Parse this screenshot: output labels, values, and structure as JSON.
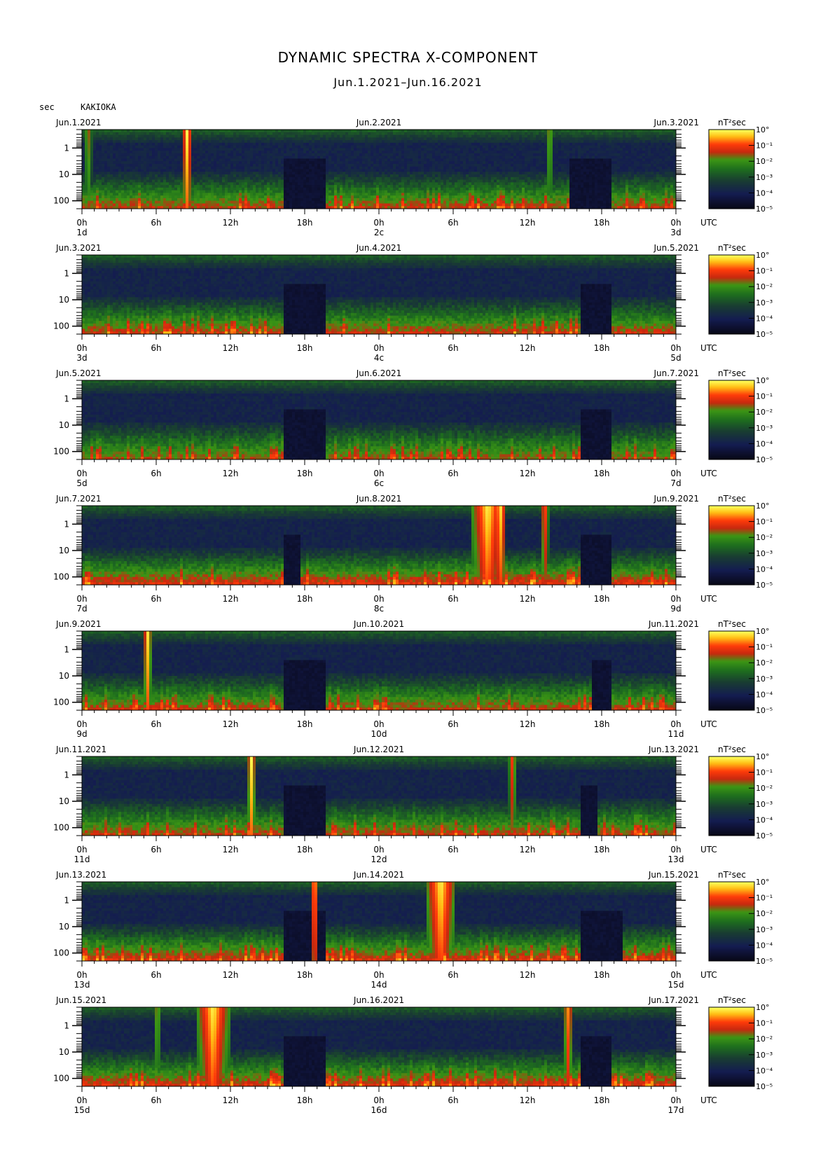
{
  "title": "DYNAMIC SPECTRA X-COMPONENT",
  "subtitle": "Jun.1.2021–Jun.16.2021",
  "y_unit": "sec",
  "station": "KAKIOKA",
  "colorbar_unit": "nT²sec",
  "colorbar_ticks": [
    "10°",
    "10⁻¹",
    "10⁻²",
    "10⁻³",
    "10⁻⁴",
    "10⁻⁵"
  ],
  "utc_label": "UTC",
  "chart_data": {
    "type": "heatmap",
    "description_axes": "x = time (hours UTC, 0-48 per panel), y = period (sec, log scale, 0.2-200), color = power spectral density",
    "x_ticks": [
      "0h",
      "6h",
      "12h",
      "18h",
      "0h",
      "6h",
      "12h",
      "18h",
      "0h"
    ],
    "y_ticks": [
      "1",
      "10",
      "100"
    ],
    "colorscale": [
      "#0a0a20",
      "#1a2060",
      "#1e4a30",
      "#2e8a20",
      "#cc2a10",
      "#ff5010",
      "#ffd020",
      "#ffff60"
    ],
    "panels": [
      {
        "left_date": "Jun.1.2021",
        "mid_date": "Jun.2.2021",
        "right_date": "Jun.3.2021",
        "day_labels": [
          "1d",
          "2c",
          "3d"
        ],
        "events": [
          {
            "t": 0.5,
            "w": 0.3,
            "intensity": 0.75
          },
          {
            "t": 8.5,
            "w": 0.4,
            "intensity": 1.0
          },
          {
            "t": 37.8,
            "w": 0.3,
            "intensity": 0.75
          }
        ],
        "quiet": [
          [
            16,
            20
          ],
          [
            39,
            43
          ]
        ],
        "activity": 0.6
      },
      {
        "left_date": "Jun.3.2021",
        "mid_date": "Jun.4.2021",
        "right_date": "Jun.5.2021",
        "day_labels": [
          "3d",
          "4c",
          "5d"
        ],
        "events": [],
        "quiet": [
          [
            16,
            20
          ],
          [
            40,
            43
          ]
        ],
        "activity": 0.65
      },
      {
        "left_date": "Jun.5.2021",
        "mid_date": "Jun.6.2021",
        "right_date": "Jun.7.2021",
        "day_labels": [
          "5d",
          "6c",
          "7d"
        ],
        "events": [],
        "quiet": [
          [
            16,
            20
          ],
          [
            40,
            43
          ]
        ],
        "activity": 0.45
      },
      {
        "left_date": "Jun.7.2021",
        "mid_date": "Jun.8.2021",
        "right_date": "Jun.9.2021",
        "day_labels": [
          "7d",
          "8c",
          "9d"
        ],
        "events": [
          {
            "t": 32.8,
            "w": 1.3,
            "intensity": 1.0
          },
          {
            "t": 33.8,
            "w": 0.5,
            "intensity": 1.0
          },
          {
            "t": 37.4,
            "w": 0.3,
            "intensity": 0.9
          }
        ],
        "quiet": [
          [
            16,
            18
          ],
          [
            40,
            43
          ]
        ],
        "activity": 0.8
      },
      {
        "left_date": "Jun.9.2021",
        "mid_date": "Jun.10.2021",
        "right_date": "Jun.11.2021",
        "day_labels": [
          "9d",
          "10d",
          "11d"
        ],
        "events": [
          {
            "t": 5.3,
            "w": 0.3,
            "intensity": 1.0
          }
        ],
        "quiet": [
          [
            16,
            20
          ],
          [
            41,
            43
          ]
        ],
        "activity": 0.6
      },
      {
        "left_date": "Jun.11.2021",
        "mid_date": "Jun.12.2021",
        "right_date": "Jun.13.2021",
        "day_labels": [
          "11d",
          "12d",
          "13d"
        ],
        "events": [
          {
            "t": 13.7,
            "w": 0.3,
            "intensity": 1.0
          },
          {
            "t": 34.8,
            "w": 0.3,
            "intensity": 0.85
          }
        ],
        "quiet": [
          [
            16,
            20
          ],
          [
            40,
            42
          ]
        ],
        "activity": 0.6
      },
      {
        "left_date": "Jun.13.2021",
        "mid_date": "Jun.14.2021",
        "right_date": "Jun.15.2021",
        "day_labels": [
          "13d",
          "14d",
          "15d"
        ],
        "events": [
          {
            "t": 18.8,
            "w": 0.3,
            "intensity": 1.0
          },
          {
            "t": 29.0,
            "w": 1.2,
            "intensity": 1.0
          }
        ],
        "quiet": [
          [
            16,
            20
          ],
          [
            40,
            44
          ]
        ],
        "activity": 0.75
      },
      {
        "left_date": "Jun.15.2021",
        "mid_date": "Jun.16.2021",
        "right_date": "Jun.17.2021",
        "day_labels": [
          "15d",
          "16d",
          "17d"
        ],
        "events": [
          {
            "t": 6.1,
            "w": 0.3,
            "intensity": 0.75
          },
          {
            "t": 10.6,
            "w": 1.3,
            "intensity": 1.0
          },
          {
            "t": 39.3,
            "w": 0.4,
            "intensity": 0.9
          }
        ],
        "quiet": [
          [
            16,
            20
          ],
          [
            40,
            43
          ]
        ],
        "activity": 0.75
      }
    ]
  }
}
